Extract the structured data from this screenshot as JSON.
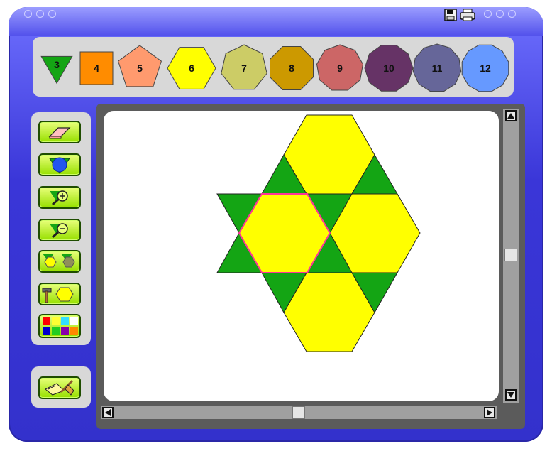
{
  "window": {
    "title_buttons": [
      "save-icon",
      "print-icon"
    ],
    "colors": {
      "frame": "#3a36d8",
      "tool_bg": "#97e000"
    }
  },
  "shapes": [
    {
      "label": "3",
      "color": "#14a514",
      "icon": "triangle"
    },
    {
      "label": "4",
      "color": "#ff8c00",
      "icon": "square"
    },
    {
      "label": "5",
      "color": "#ff9a6e",
      "icon": "pentagon"
    },
    {
      "label": "6",
      "color": "#ffff00",
      "icon": "hexagon"
    },
    {
      "label": "7",
      "color": "#cccc66",
      "icon": "heptagon"
    },
    {
      "label": "8",
      "color": "#cc9900",
      "icon": "octagon"
    },
    {
      "label": "9",
      "color": "#cc6666",
      "icon": "nonagon"
    },
    {
      "label": "10",
      "color": "#663366",
      "icon": "decagon"
    },
    {
      "label": "11",
      "color": "#666699",
      "icon": "hendecagon"
    },
    {
      "label": "12",
      "color": "#6699ff",
      "icon": "dodecagon"
    }
  ],
  "tools": [
    {
      "name": "eraser-tool",
      "icon": "eraser-icon"
    },
    {
      "name": "rotate-tool",
      "icon": "rotate-icon"
    },
    {
      "name": "zoom-in-tool",
      "icon": "zoom-in-icon"
    },
    {
      "name": "zoom-out-tool",
      "icon": "zoom-out-icon"
    },
    {
      "name": "clone-tool",
      "icon": "clone-icon"
    },
    {
      "name": "build-tool",
      "icon": "hammer-icon"
    },
    {
      "name": "color-palette-tool",
      "icon": "palette-icon"
    },
    {
      "name": "clear-tool",
      "icon": "broom-icon"
    }
  ],
  "canvas": {
    "pieces": [
      {
        "type": "hexagon",
        "color": "#ffff00"
      },
      {
        "type": "hexagon",
        "color": "#ffff00"
      },
      {
        "type": "hexagon",
        "color": "#ffff00"
      },
      {
        "type": "hexagon",
        "color": "#ffff00"
      },
      {
        "type": "triangle",
        "color": "#14a514"
      },
      {
        "type": "triangle",
        "color": "#14a514"
      },
      {
        "type": "triangle",
        "color": "#14a514"
      },
      {
        "type": "triangle",
        "color": "#14a514"
      },
      {
        "type": "triangle",
        "color": "#14a514"
      },
      {
        "type": "triangle",
        "color": "#14a514"
      },
      {
        "type": "triangle",
        "color": "#14a514"
      },
      {
        "type": "triangle",
        "color": "#14a514"
      }
    ],
    "selected_piece_outline": "#ff3399"
  }
}
